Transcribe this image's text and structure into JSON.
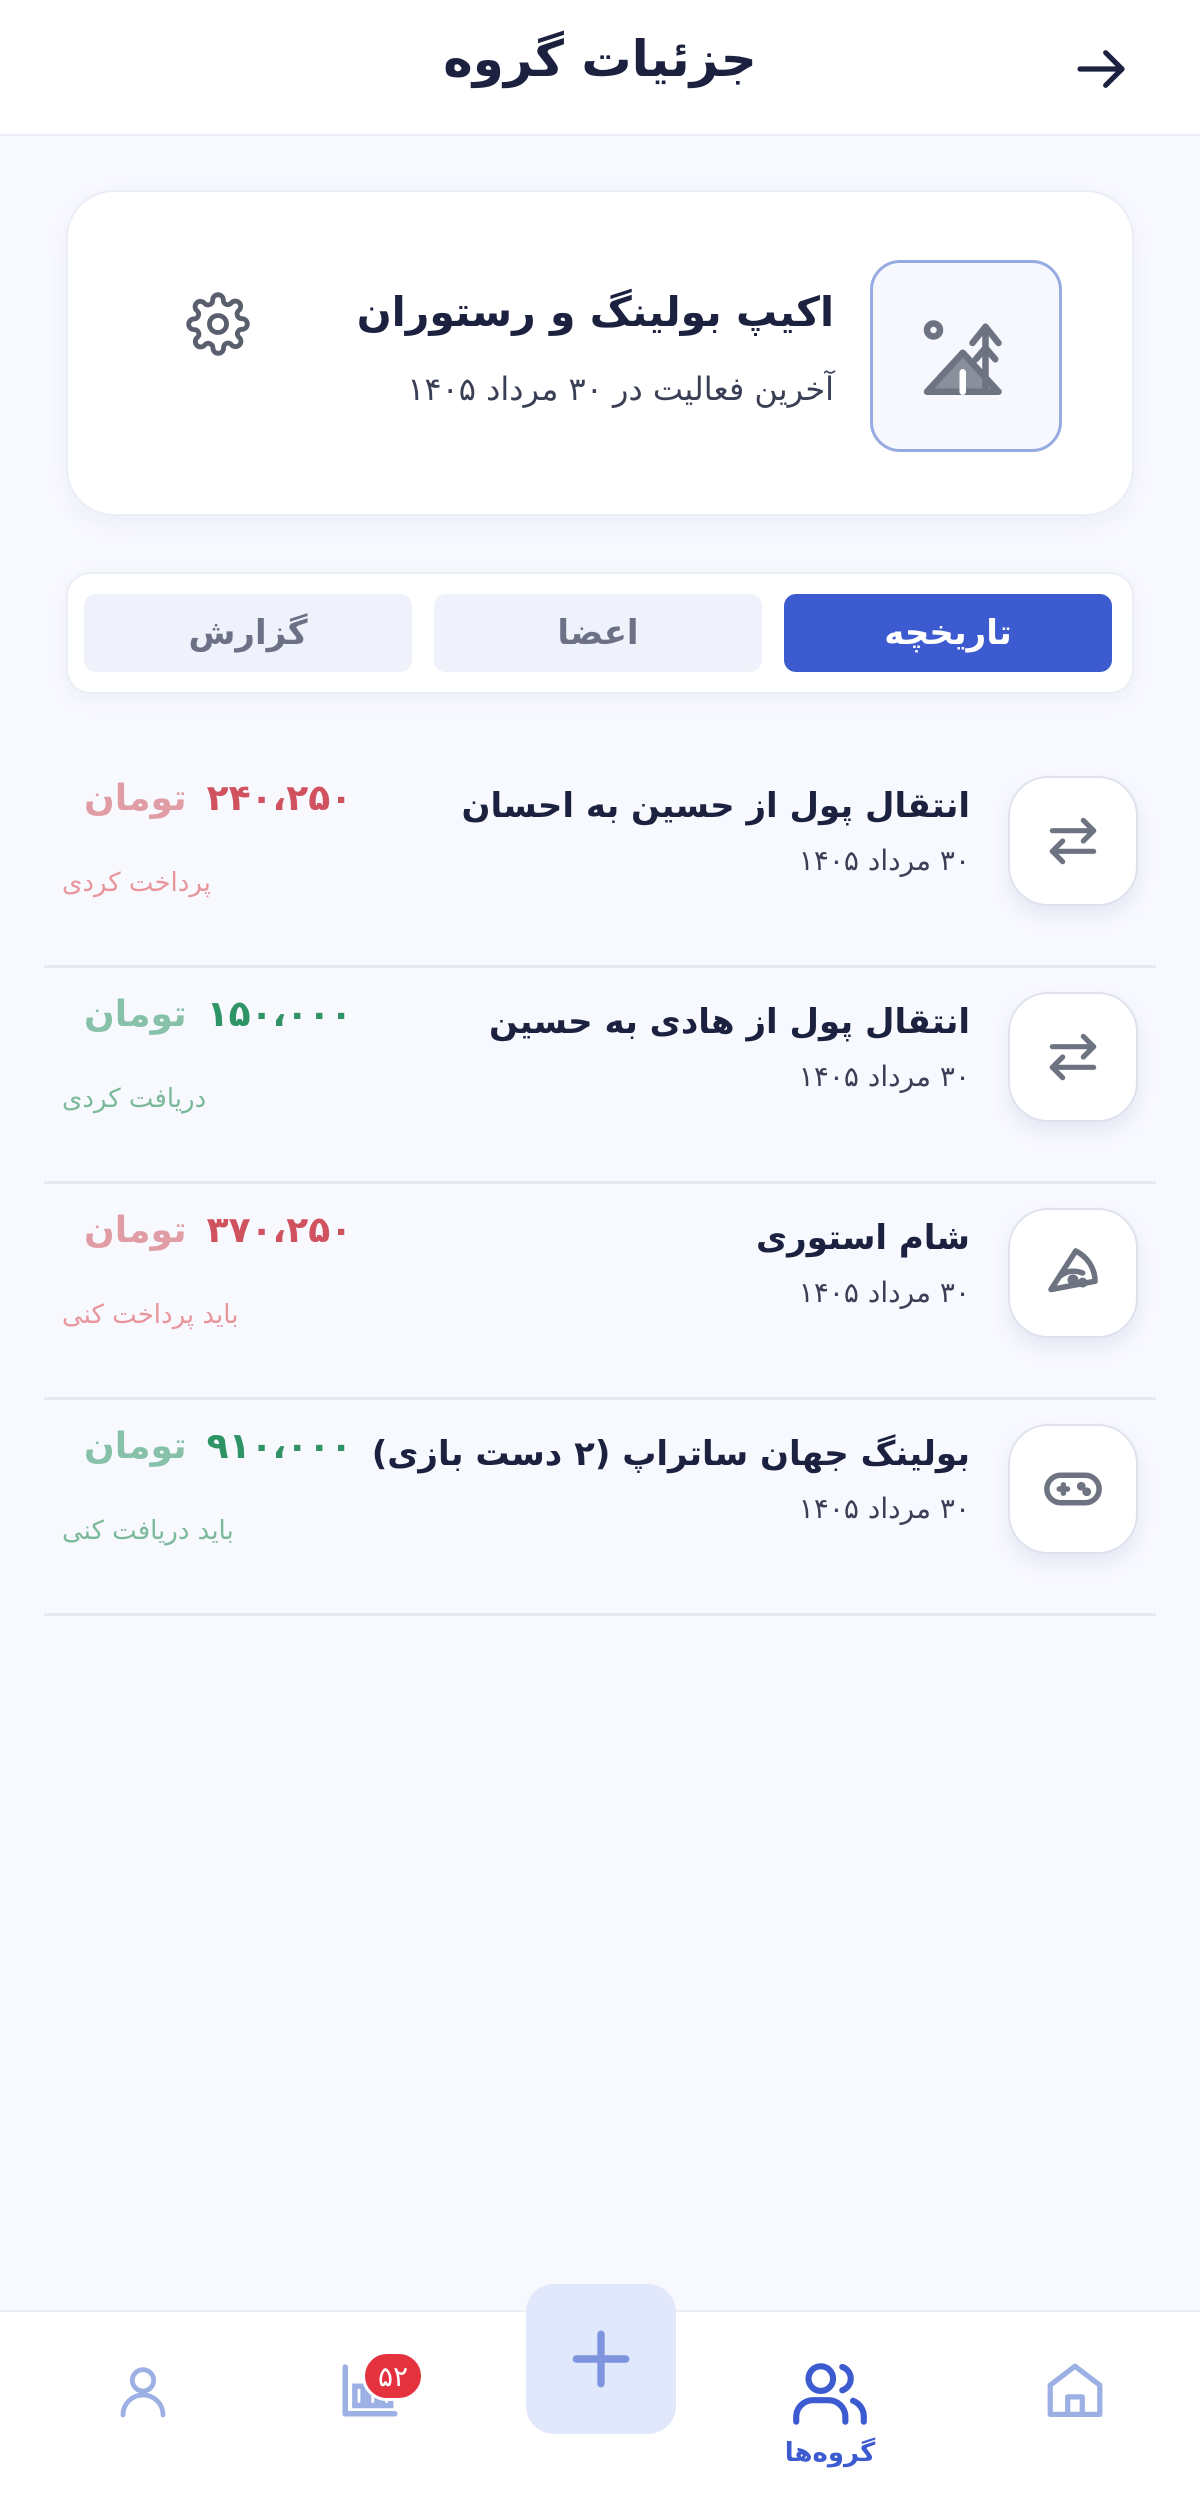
{
  "header": {
    "title": "جزئیات گروه",
    "back_icon": "arrow-right-icon"
  },
  "group": {
    "name": "اکیپ بولینگ و رستوران",
    "last_activity": "آخرین فعالیت در ۳۰ مرداد ۱۴۰۵",
    "avatar_icon": "camping-tent-icon",
    "settings_icon": "gear-icon"
  },
  "tabs": [
    {
      "label": "تاریخچه",
      "active": true
    },
    {
      "label": "اعضا",
      "active": false
    },
    {
      "label": "گزارش",
      "active": false
    }
  ],
  "transactions": [
    {
      "icon": "transfer-arrows-icon",
      "title": "انتقال پول از حسین به احسان",
      "date": "۳۰ مرداد ۱۴۰۵",
      "amount": "۲۴۰،۲۵۰",
      "currency": "تومان",
      "status": "پرداخت کردی",
      "tone": "negative"
    },
    {
      "icon": "transfer-arrows-icon",
      "title": "انتقال پول از هادی به حسین",
      "date": "۳۰ مرداد ۱۴۰۵",
      "amount": "۱۵۰،۰۰۰",
      "currency": "تومان",
      "status": "دریافت کردی",
      "tone": "positive"
    },
    {
      "icon": "pizza-slice-icon",
      "title": "شام استوری",
      "date": "۳۰ مرداد ۱۴۰۵",
      "amount": "۳۷۰،۲۵۰",
      "currency": "تومان",
      "status": "باید پرداخت کنی",
      "tone": "negative"
    },
    {
      "icon": "gamepad-icon",
      "title": "بولینگ جهان ساتراپ (۲ دست بازی)",
      "date": "۳۰ مرداد ۱۴۰۵",
      "amount": "۹۱۰،۰۰۰",
      "currency": "تومان",
      "status": "باید دریافت کنی",
      "tone": "positive"
    }
  ],
  "bottom_nav": {
    "groups_label": "گروه‌ها",
    "badge_count": "۵۲",
    "active_item": "groups",
    "accent_color": "#3d5bd0"
  }
}
